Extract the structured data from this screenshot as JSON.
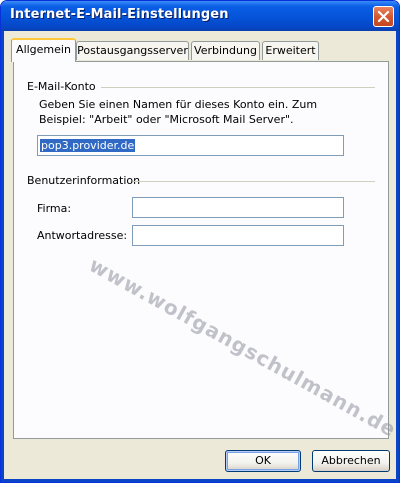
{
  "window": {
    "title": "Internet-E-Mail-Einstellungen",
    "close_icon": "close-icon"
  },
  "tabs": [
    {
      "label": "Allgemein",
      "active": true
    },
    {
      "label": "Postausgangsserver",
      "active": false
    },
    {
      "label": "Verbindung",
      "active": false
    },
    {
      "label": "Erweitert",
      "active": false
    }
  ],
  "email_account": {
    "group_title": "E-Mail-Konto",
    "description": "Geben Sie einen Namen für dieses Konto ein. Zum Beispiel: \"Arbeit\" oder \"Microsoft Mail Server\".",
    "account_name_value": "pop3.provider.de"
  },
  "user_info": {
    "group_title": "Benutzerinformation",
    "company_label": "Firma:",
    "company_value": "",
    "reply_label": "Antwortadresse:",
    "reply_value": ""
  },
  "watermark": "www.wolfgangschulmann.de",
  "buttons": {
    "ok": "OK",
    "cancel": "Abbrechen"
  },
  "colors": {
    "titlebar": "#0553d8",
    "dialog_bg": "#ece9d8",
    "tab_highlight": "#ffc83c",
    "selection": "#316ac5"
  }
}
